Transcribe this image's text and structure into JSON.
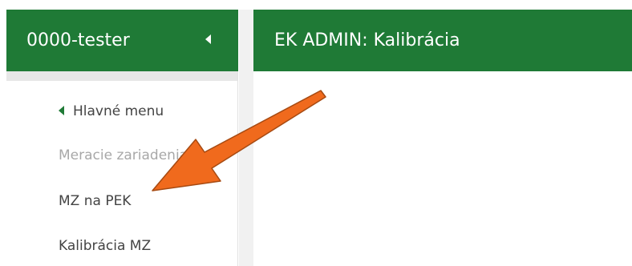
{
  "sidebar": {
    "title": "0000-tester",
    "collapse_icon": "caret-left-icon",
    "menu": {
      "back_label": "Hlavné menu",
      "back_icon": "caret-left-icon",
      "items": [
        {
          "label": "Meracie zariadenia",
          "disabled": true
        },
        {
          "label": "MZ na PEK",
          "disabled": false
        },
        {
          "label": "Kalibrácia MZ",
          "disabled": false
        }
      ]
    }
  },
  "main": {
    "title": "EK ADMIN: Kalibrácia"
  },
  "annotation": {
    "type": "arrow",
    "icon": "arrow-pointer-icon",
    "color": "#f06a1d",
    "outline": "#a64a12",
    "target": "MZ na PEK"
  },
  "colors": {
    "header_green": "#1f7a36",
    "header_text": "#ffffff",
    "menu_text": "#444444",
    "menu_disabled": "#a8a8a8"
  }
}
